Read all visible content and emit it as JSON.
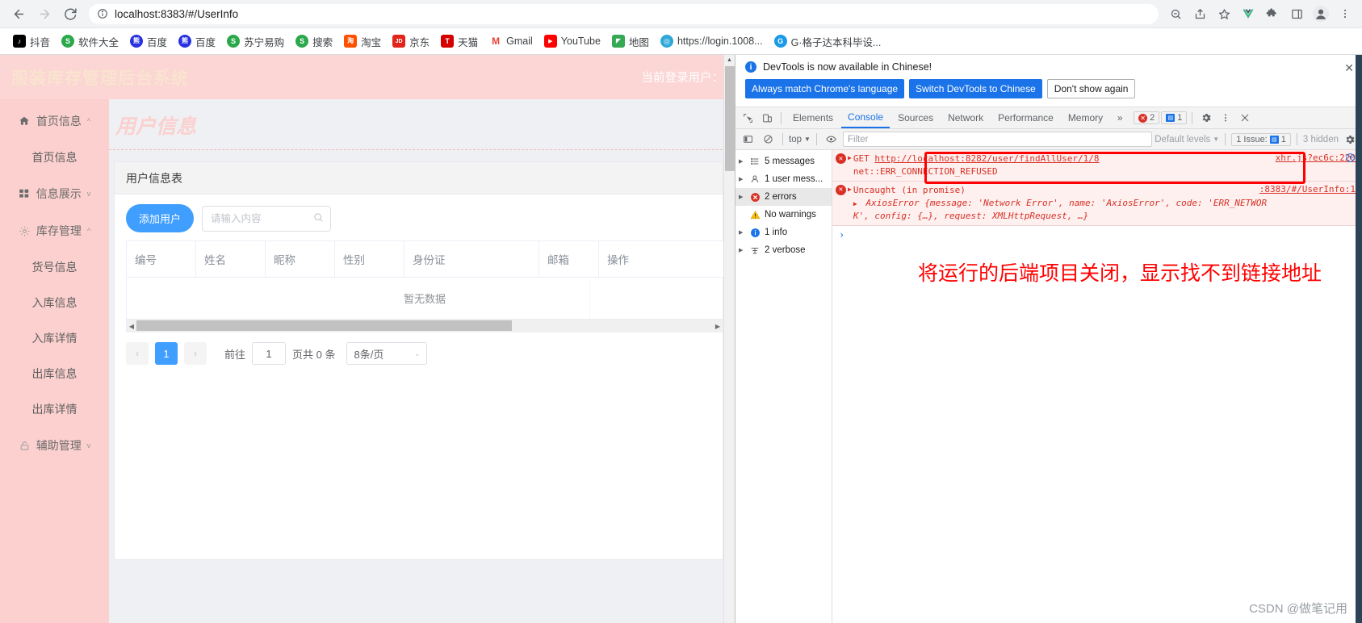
{
  "browser": {
    "nav": {
      "back": "←",
      "forward": "→",
      "reload": "⟳"
    },
    "omnibox": {
      "site_info_icon": "info-circle-icon",
      "url": "localhost:8383/#/UserInfo"
    },
    "omnibox_right_icons": [
      "zoom-out-icon",
      "share-icon",
      "bookmark-star-icon"
    ],
    "toolbar_right_icons": [
      "vue-devtools-icon",
      "extensions-puzzle-icon",
      "side-panel-icon",
      "profile-avatar-icon",
      "chrome-menu-icon"
    ],
    "bookmarks": [
      {
        "label": "抖音",
        "glyph": "♪",
        "bg": "#000000"
      },
      {
        "label": "软件大全",
        "glyph": "S",
        "bg": "#34a853"
      },
      {
        "label": "百度",
        "glyph": "熊",
        "bg": "#2932e1"
      },
      {
        "label": "百度",
        "glyph": "熊",
        "bg": "#2932e1"
      },
      {
        "label": "苏宁易购",
        "glyph": "S",
        "bg": "#34a853"
      },
      {
        "label": "搜索",
        "glyph": "S",
        "bg": "#34a853"
      },
      {
        "label": "淘宝",
        "glyph": "淘",
        "bg": "#ff5000"
      },
      {
        "label": "京东",
        "glyph": "JD",
        "bg": "#e1251b"
      },
      {
        "label": "天猫",
        "glyph": "T",
        "bg": "#d40000"
      },
      {
        "label": "Gmail",
        "glyph": "M",
        "bg": "#ffffff"
      },
      {
        "label": "YouTube",
        "glyph": "▶",
        "bg": "#ff0000"
      },
      {
        "label": "地图",
        "glyph": "📍",
        "bg": "#ffffff"
      },
      {
        "label": "https://login.1008...",
        "glyph": "◎",
        "bg": "#2fa8d8"
      },
      {
        "label": "G·格子达本科毕设...",
        "glyph": "G",
        "bg": "#1a9ae8"
      }
    ]
  },
  "app": {
    "title": "服装库存管理后台系统",
    "current_user_label": "当前登录用户：",
    "watermark_title": "用户信息",
    "sidebar": [
      {
        "type": "group",
        "label": "首页信息",
        "icon": "home-icon",
        "caret": "^"
      },
      {
        "type": "item",
        "label": "首页信息"
      },
      {
        "type": "group",
        "label": "信息展示",
        "icon": "grid-icon",
        "caret": "v"
      },
      {
        "type": "group",
        "label": "库存管理",
        "icon": "gear-icon",
        "caret": "^"
      },
      {
        "type": "item",
        "label": "货号信息"
      },
      {
        "type": "item",
        "label": "入库信息"
      },
      {
        "type": "item",
        "label": "入库详情"
      },
      {
        "type": "item",
        "label": "出库信息"
      },
      {
        "type": "item",
        "label": "出库详情"
      },
      {
        "type": "group",
        "label": "辅助管理",
        "icon": "lock-icon",
        "caret": "v"
      }
    ],
    "card": {
      "title": "用户信息表",
      "add_button": "添加用户",
      "search_placeholder": "请输入内容",
      "search_value": "",
      "search_icon": "magnifier-icon",
      "columns": [
        "编号",
        "姓名",
        "昵称",
        "性别",
        "身份证",
        "邮箱",
        "操作"
      ],
      "rows": [],
      "empty_text": "暂无数据"
    },
    "pagination": {
      "prev": "‹",
      "next": "›",
      "current_page": "1",
      "goto_label": "前往",
      "goto_value": "1",
      "total_label": "页共 0 条",
      "page_size": "8条/页",
      "caret": "⌄"
    }
  },
  "devtools": {
    "banner": {
      "message": "DevTools is now available in Chinese!",
      "btn_always": "Always match Chrome's language",
      "btn_switch": "Switch DevTools to Chinese",
      "btn_dismiss": "Don't show again",
      "close": "✕"
    },
    "tabs": [
      {
        "label": "Elements",
        "active": false
      },
      {
        "label": "Console",
        "active": true
      },
      {
        "label": "Sources",
        "active": false
      },
      {
        "label": "Network",
        "active": false
      },
      {
        "label": "Performance",
        "active": false
      },
      {
        "label": "Memory",
        "active": false
      }
    ],
    "tabs_overflow": "»",
    "error_badge": "2",
    "message_badge": "1",
    "settings_icon": "gear-icon",
    "more_icon": "kebab-menu-icon",
    "close_icon": "close-icon",
    "filterbar": {
      "sidebar_toggle_icon": "sidebar-toggle-icon",
      "clear_icon": "clear-console-icon",
      "context": "top",
      "context_caret": "▼",
      "eye_icon": "live-expression-icon",
      "filter_placeholder": "Filter",
      "filter_value": "",
      "levels": "Default levels",
      "levels_caret": "▼",
      "issues": "1 Issue:",
      "issues_count": "1",
      "hidden": "3 hidden",
      "settings_icon": "gear-icon"
    },
    "sidebar": [
      {
        "label": "5 messages",
        "icon": "list-icon",
        "tri": "▶",
        "selected": false
      },
      {
        "label": "1 user mess...",
        "icon": "person-icon",
        "tri": "▶",
        "selected": false
      },
      {
        "label": "2 errors",
        "icon": "error-icon",
        "tri": "▶",
        "selected": true
      },
      {
        "label": "No warnings",
        "icon": "warning-icon",
        "tri": "",
        "selected": false
      },
      {
        "label": "1 info",
        "icon": "info-icon",
        "tri": "▶",
        "selected": false
      },
      {
        "label": "2 verbose",
        "icon": "verbose-icon",
        "tri": "▶",
        "selected": false
      }
    ],
    "console": {
      "error1_method": "GET",
      "error1_url": "http://localhost:8282/user/findAllUser/1/8",
      "error1_detail": "net::ERR_CONNECTION_REFUSED",
      "error1_source": "xhr.js?ec6c:220",
      "error1_source_icon": "open-in-new-icon",
      "error2_title": "Uncaught (in promise)",
      "error2_source": ":8383/#/UserInfo:1",
      "error2_body_line1": "AxiosError {message: 'Network Error', name: 'AxiosError', code: 'ERR_NETWOR",
      "error2_body_line2": "K', config: {…}, request: XMLHttpRequest, …}",
      "prompt": "›"
    },
    "annotation": "将运行的后端项目关闭，显示找不到链接地址",
    "watermark": "CSDN @做笔记用"
  }
}
